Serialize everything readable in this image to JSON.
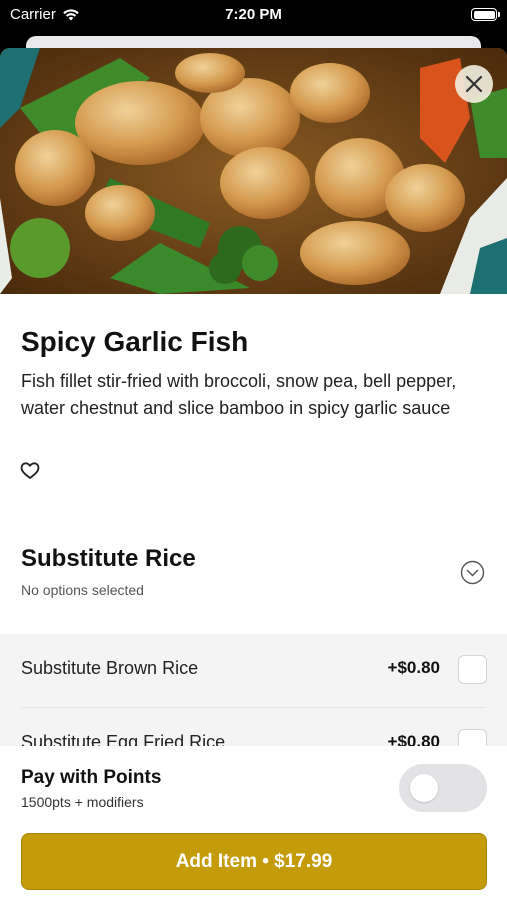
{
  "status_bar": {
    "carrier": "Carrier",
    "time": "7:20 PM"
  },
  "item": {
    "name": "Spicy Garlic Fish",
    "description": "Fish fillet stir-fried with broccoli, snow pea, bell pepper, water chestnut and slice bamboo in spicy garlic sauce",
    "image_icon": "food-photo"
  },
  "modifier_group": {
    "title": "Substitute Rice",
    "subtitle": "No options selected",
    "options": [
      {
        "label": "Substitute Brown Rice",
        "price": "+$0.80",
        "checked": false
      },
      {
        "label": "Substitute Egg Fried Rice",
        "price": "+$0.80",
        "checked": false
      }
    ]
  },
  "points": {
    "title": "Pay with Points",
    "subtitle": "1500pts + modifiers",
    "enabled": false
  },
  "cta": {
    "label": "Add Item • $17.99"
  },
  "colors": {
    "accent": "#c49c0b",
    "option_bg": "#f4f4f5",
    "toggle_off": "#e3e3e6"
  }
}
